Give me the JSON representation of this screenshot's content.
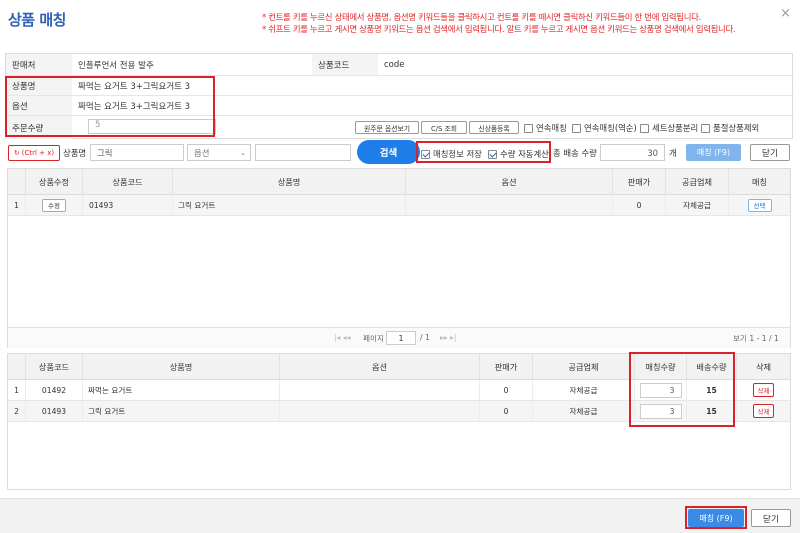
{
  "title": "상품 매칭",
  "notes": [
    "* 컨트롤 키를 누르신 상태에서 상품명, 옵션명 키워드들을 클릭하시고 컨트롤 키를 떼시면 클릭하신 키워드들이 한 번에 입력됩니다.",
    "* 쉬프트 키를 누르고 게시면 상품명 키워드는 옵션 검색에서 입력됩니다. 알트 키를 누르고 게시면 옵션 키워드는 상품명 검색에서 입력됩니다."
  ],
  "close_icon": "×",
  "info": {
    "seller_label": "판매처",
    "seller_value": "인플루언서 전용 발주",
    "code_label": "상품코드",
    "code_value": "code",
    "product_label": "상품명",
    "product_value": "짜먹는 요거트 3+그릭요거트 3",
    "option_label": "옵션",
    "option_value": "짜먹는 요거트 3+그릭요거트 3",
    "qty_label": "주문수량",
    "qty_value": "5",
    "btn_view_original": "원주문 옵션보기",
    "btn_cs": "C/S 조회",
    "btn_new_product": "신상품등록",
    "cb_continuous": "연속매칭",
    "cb_continuous_reverse": "연속매칭(역순)",
    "cb_set_split": "세트상품분리",
    "cb_discontinued": "품절상품제외"
  },
  "search": {
    "reset_label": "(Ctrl + x)",
    "product_label": "상품명",
    "product_value": "그릭",
    "option_placeholder": "옵션",
    "search_btn": "검색",
    "cb_save_info": "매칭정보 저장",
    "cb_auto_qty": "수량 자동계산",
    "total_label": "총 배송 수량",
    "total_value": "30",
    "unit": "개",
    "match_btn": "매칭 (F9)",
    "close_btn": "닫기"
  },
  "grid1": {
    "headers": [
      "상품수정",
      "상품코드",
      "상품명",
      "옵션",
      "판매가",
      "공급업체",
      "매칭"
    ],
    "rows": [
      {
        "num": "1",
        "edit": "수정",
        "code": "01493",
        "name": "그릭 요거트",
        "option": "",
        "price": "0",
        "supplier": "자체공급",
        "select": "선택"
      }
    ],
    "pager": {
      "page_label": "페이지",
      "page": "1",
      "of": "/ 1",
      "count": "보기 1 - 1 / 1"
    }
  },
  "grid2": {
    "headers": [
      "상품코드",
      "상품명",
      "옵션",
      "판매가",
      "공급업체",
      "매칭수량",
      "배송수량",
      "삭제"
    ],
    "rows": [
      {
        "num": "1",
        "code": "01492",
        "name": "짜먹는 요거트",
        "option": "",
        "price": "0",
        "supplier": "자체공급",
        "match_qty": "3",
        "ship_qty": "15",
        "del": "삭제"
      },
      {
        "num": "2",
        "code": "01493",
        "name": "그릭 요거트",
        "option": "",
        "price": "0",
        "supplier": "자체공급",
        "match_qty": "3",
        "ship_qty": "15",
        "del": "삭제"
      }
    ]
  },
  "footer": {
    "match_btn": "매칭 (F9)",
    "close_btn": "닫기"
  }
}
